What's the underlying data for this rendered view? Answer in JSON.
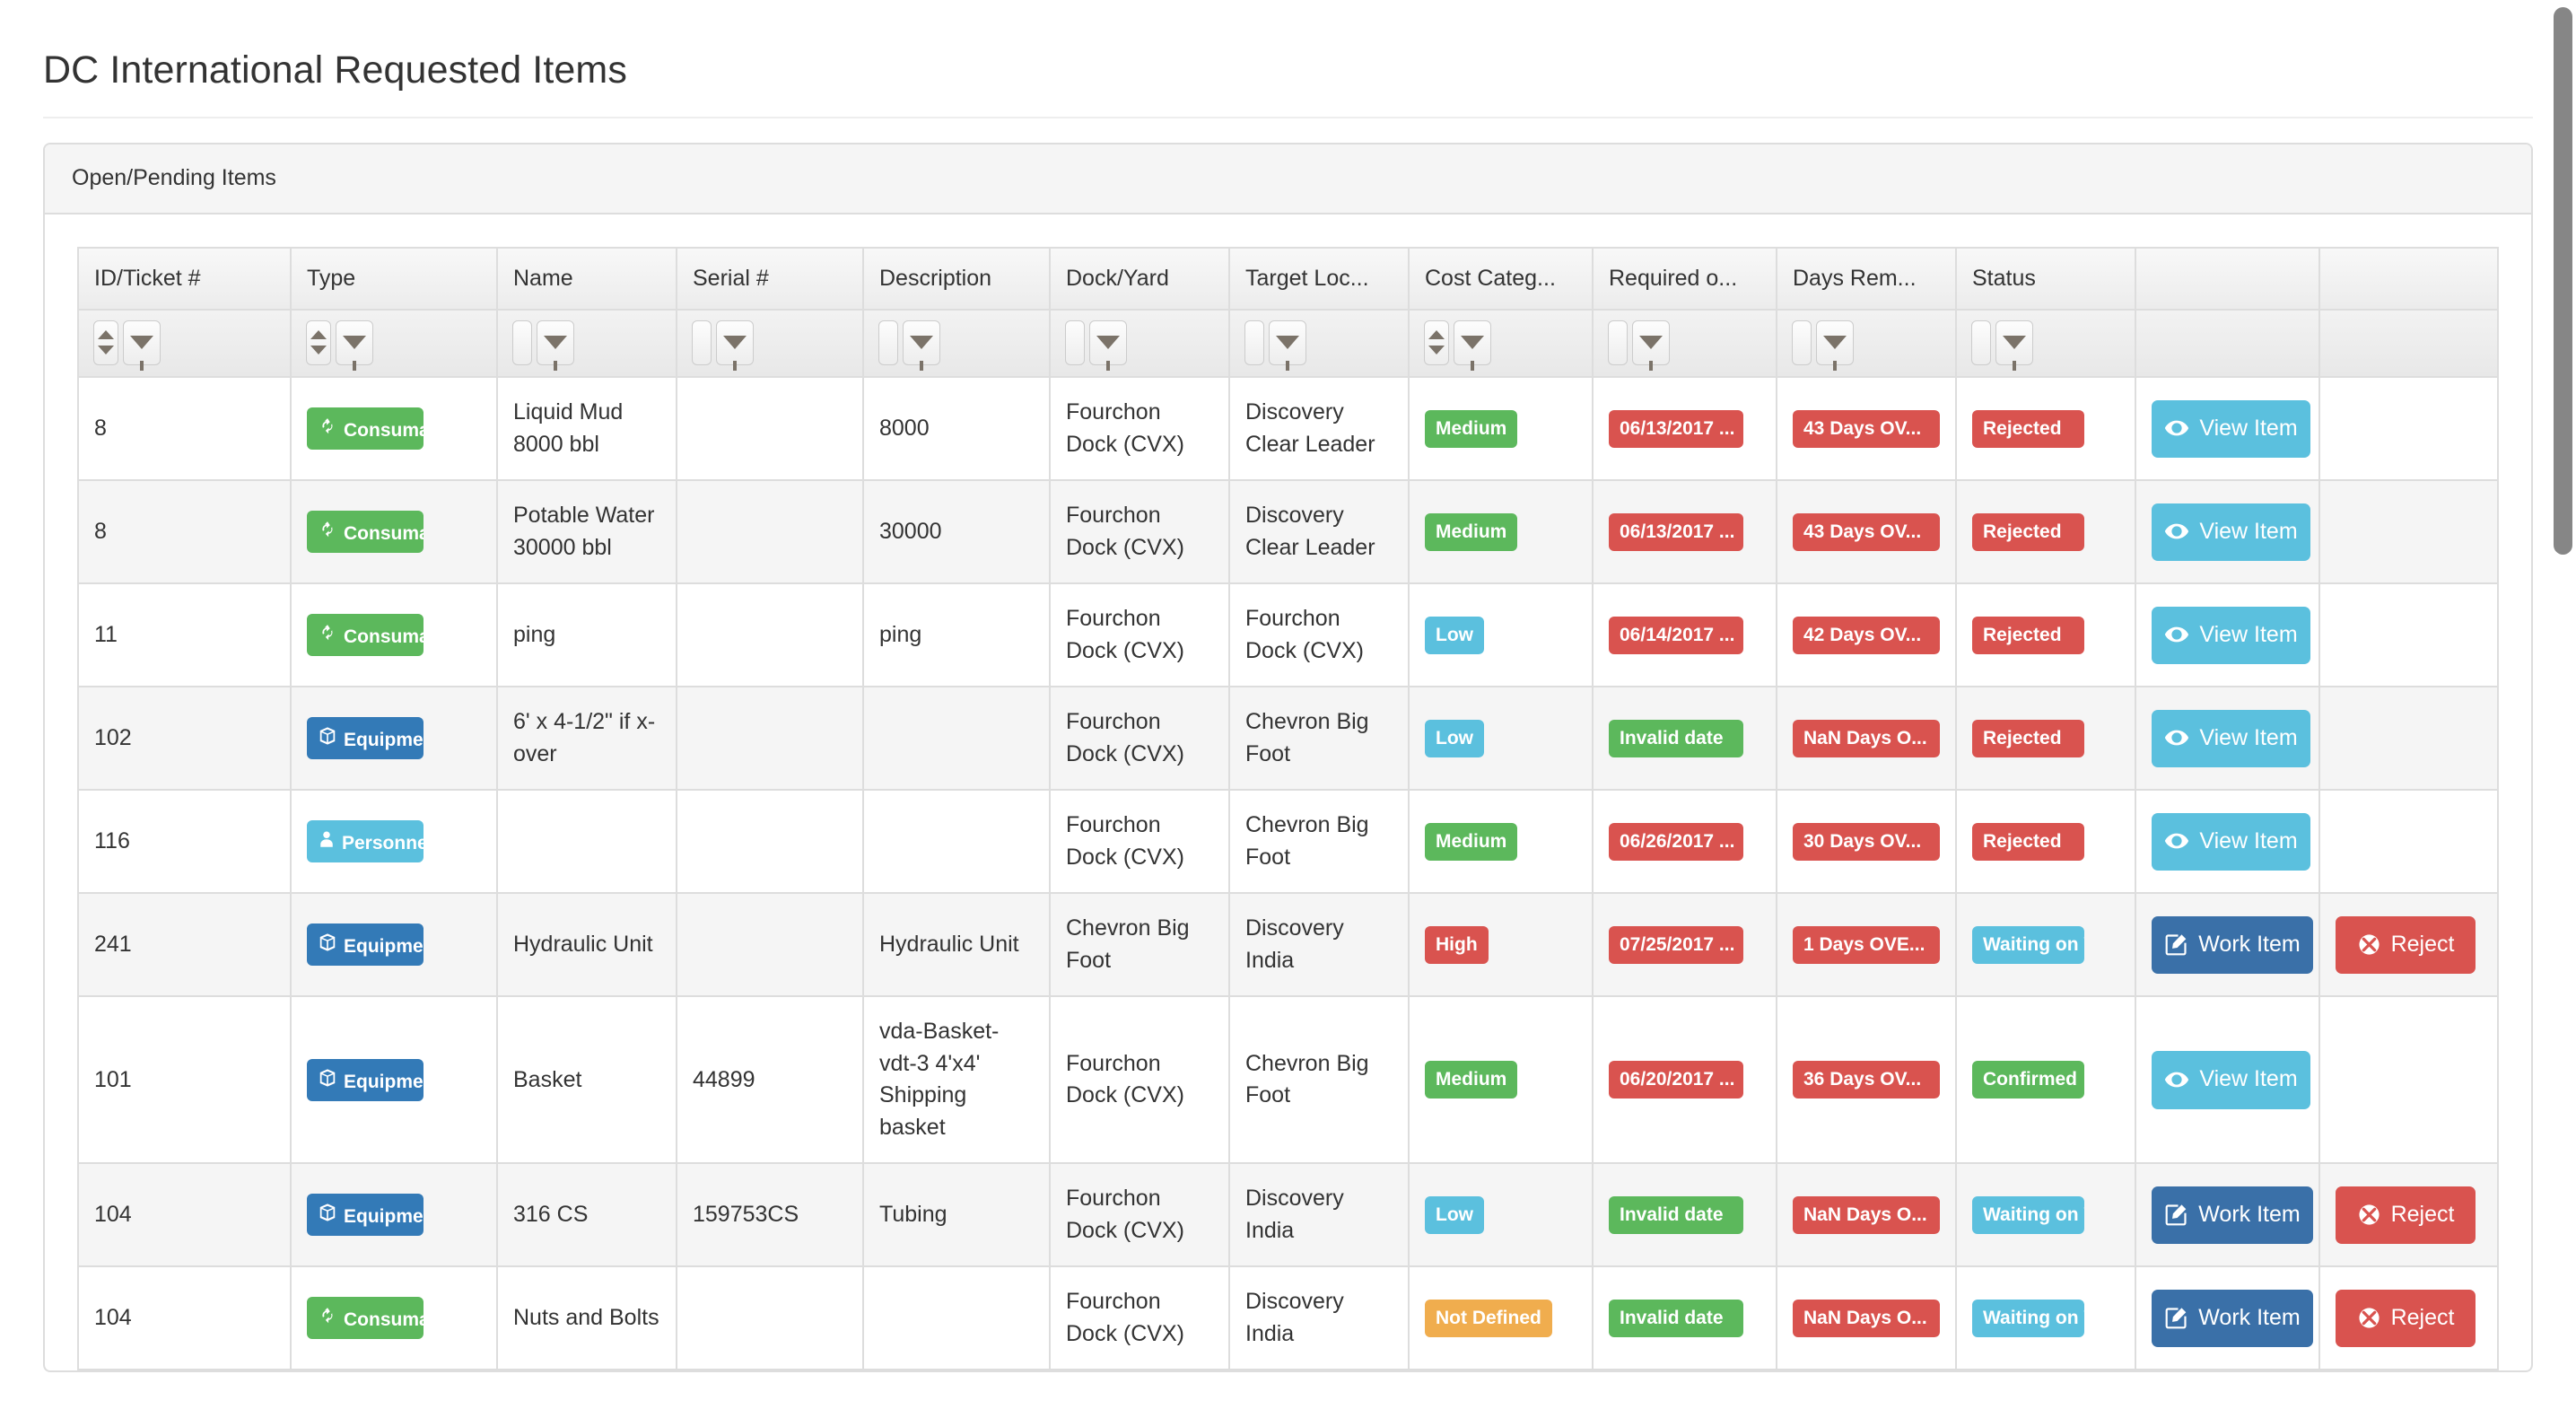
{
  "page": {
    "title": "DC International Requested Items"
  },
  "panel": {
    "heading": "Open/Pending Items"
  },
  "grid": {
    "columns": [
      {
        "label": "ID/Ticket #",
        "sortable": true,
        "filter": true
      },
      {
        "label": "Type",
        "sortable": true,
        "filter": true
      },
      {
        "label": "Name",
        "sortable": false,
        "filter": true
      },
      {
        "label": "Serial #",
        "sortable": false,
        "filter": true
      },
      {
        "label": "Description",
        "sortable": false,
        "filter": true
      },
      {
        "label": "Dock/Yard",
        "sortable": false,
        "filter": true
      },
      {
        "label": "Target Loc...",
        "sortable": false,
        "filter": true
      },
      {
        "label": "Cost Categ...",
        "sortable": true,
        "filter": true
      },
      {
        "label": "Required o...",
        "sortable": false,
        "filter": true
      },
      {
        "label": "Days Rem...",
        "sortable": false,
        "filter": true
      },
      {
        "label": "Status",
        "sortable": false,
        "filter": true
      },
      {
        "label": "",
        "sortable": false,
        "filter": false
      },
      {
        "label": "",
        "sortable": false,
        "filter": false
      }
    ],
    "rows": [
      {
        "id": "8",
        "type": {
          "text": "Consuma...",
          "color": "green",
          "icon": "recycle-icon"
        },
        "name": "Liquid Mud 8000 bbl",
        "serial": "",
        "description": "8000",
        "dock_yard": "Fourchon Dock (CVX)",
        "target_location": "Discovery Clear Leader",
        "cost_category": {
          "text": "Medium",
          "color": "green"
        },
        "required_on": {
          "text": "06/13/2017 ...",
          "color": "red"
        },
        "days_remaining": {
          "text": "43 Days OV...",
          "color": "red"
        },
        "status": {
          "text": "Rejected",
          "color": "red"
        },
        "primary_action": {
          "label": "View Item",
          "style": "view",
          "icon": "eye-icon"
        },
        "secondary_action": null
      },
      {
        "id": "8",
        "type": {
          "text": "Consuma...",
          "color": "green",
          "icon": "recycle-icon"
        },
        "name": "Potable Water 30000 bbl",
        "serial": "",
        "description": "30000",
        "dock_yard": "Fourchon Dock (CVX)",
        "target_location": "Discovery Clear Leader",
        "cost_category": {
          "text": "Medium",
          "color": "green"
        },
        "required_on": {
          "text": "06/13/2017 ...",
          "color": "red"
        },
        "days_remaining": {
          "text": "43 Days OV...",
          "color": "red"
        },
        "status": {
          "text": "Rejected",
          "color": "red"
        },
        "primary_action": {
          "label": "View Item",
          "style": "view",
          "icon": "eye-icon"
        },
        "secondary_action": null
      },
      {
        "id": "11",
        "type": {
          "text": "Consuma...",
          "color": "green",
          "icon": "recycle-icon"
        },
        "name": "ping",
        "serial": "",
        "description": "ping",
        "dock_yard": "Fourchon Dock (CVX)",
        "target_location": "Fourchon Dock (CVX)",
        "cost_category": {
          "text": "Low",
          "color": "lblue"
        },
        "required_on": {
          "text": "06/14/2017 ...",
          "color": "red"
        },
        "days_remaining": {
          "text": "42 Days OV...",
          "color": "red"
        },
        "status": {
          "text": "Rejected",
          "color": "red"
        },
        "primary_action": {
          "label": "View Item",
          "style": "view",
          "icon": "eye-icon"
        },
        "secondary_action": null
      },
      {
        "id": "102",
        "type": {
          "text": "Equipment",
          "color": "blue",
          "icon": "cube-icon"
        },
        "name": "6' x 4-1/2\" if x- over",
        "serial": "",
        "description": "",
        "dock_yard": "Fourchon Dock (CVX)",
        "target_location": "Chevron Big Foot",
        "cost_category": {
          "text": "Low",
          "color": "lblue"
        },
        "required_on": {
          "text": "Invalid date",
          "color": "green"
        },
        "days_remaining": {
          "text": "NaN Days O...",
          "color": "red"
        },
        "status": {
          "text": "Rejected",
          "color": "red"
        },
        "primary_action": {
          "label": "View Item",
          "style": "view",
          "icon": "eye-icon"
        },
        "secondary_action": null
      },
      {
        "id": "116",
        "type": {
          "text": "Personnel",
          "color": "lblue",
          "icon": "user-icon"
        },
        "name": "",
        "serial": "",
        "description": "",
        "dock_yard": "Fourchon Dock (CVX)",
        "target_location": "Chevron Big Foot",
        "cost_category": {
          "text": "Medium",
          "color": "green"
        },
        "required_on": {
          "text": "06/26/2017 ...",
          "color": "red"
        },
        "days_remaining": {
          "text": "30 Days OV...",
          "color": "red"
        },
        "status": {
          "text": "Rejected",
          "color": "red"
        },
        "primary_action": {
          "label": "View Item",
          "style": "view",
          "icon": "eye-icon"
        },
        "secondary_action": null
      },
      {
        "id": "241",
        "type": {
          "text": "Equipment",
          "color": "blue",
          "icon": "cube-icon"
        },
        "name": "Hydraulic Unit",
        "serial": "",
        "description": "Hydraulic Unit",
        "dock_yard": "Chevron Big Foot",
        "target_location": "Discovery India",
        "cost_category": {
          "text": "High",
          "color": "red"
        },
        "required_on": {
          "text": "07/25/2017 ...",
          "color": "red"
        },
        "days_remaining": {
          "text": "1 Days OVE...",
          "color": "red"
        },
        "status": {
          "text": "Waiting on V...",
          "color": "lblue"
        },
        "primary_action": {
          "label": "Work Item",
          "style": "work",
          "icon": "edit-icon"
        },
        "secondary_action": {
          "label": "Reject",
          "style": "reject",
          "icon": "ban-icon"
        }
      },
      {
        "id": "101",
        "type": {
          "text": "Equipment",
          "color": "blue",
          "icon": "cube-icon"
        },
        "name": "Basket",
        "serial": "44899",
        "description": "vda-Basket-vdt-3 4'x4' Shipping basket",
        "dock_yard": "Fourchon Dock (CVX)",
        "target_location": "Chevron Big Foot",
        "cost_category": {
          "text": "Medium",
          "color": "green"
        },
        "required_on": {
          "text": "06/20/2017 ...",
          "color": "red"
        },
        "days_remaining": {
          "text": "36 Days OV...",
          "color": "red"
        },
        "status": {
          "text": "Confirmed",
          "color": "green"
        },
        "primary_action": {
          "label": "View Item",
          "style": "view",
          "icon": "eye-icon"
        },
        "secondary_action": null
      },
      {
        "id": "104",
        "type": {
          "text": "Equipment",
          "color": "blue",
          "icon": "cube-icon"
        },
        "name": "316 CS",
        "serial": "159753CS",
        "description": "Tubing",
        "dock_yard": "Fourchon Dock (CVX)",
        "target_location": "Discovery India",
        "cost_category": {
          "text": "Low",
          "color": "lblue"
        },
        "required_on": {
          "text": "Invalid date",
          "color": "green"
        },
        "days_remaining": {
          "text": "NaN Days O...",
          "color": "red"
        },
        "status": {
          "text": "Waiting on V...",
          "color": "lblue"
        },
        "primary_action": {
          "label": "Work Item",
          "style": "work",
          "icon": "edit-icon"
        },
        "secondary_action": {
          "label": "Reject",
          "style": "reject",
          "icon": "ban-icon"
        }
      },
      {
        "id": "104",
        "type": {
          "text": "Consuma...",
          "color": "green",
          "icon": "recycle-icon"
        },
        "name": "Nuts and Bolts",
        "serial": "",
        "description": "",
        "dock_yard": "Fourchon Dock (CVX)",
        "target_location": "Discovery India",
        "cost_category": {
          "text": "Not Defined",
          "color": "orange"
        },
        "required_on": {
          "text": "Invalid date",
          "color": "green"
        },
        "days_remaining": {
          "text": "NaN Days O...",
          "color": "red"
        },
        "status": {
          "text": "Waiting on V...",
          "color": "lblue"
        },
        "primary_action": {
          "label": "Work Item",
          "style": "work",
          "icon": "edit-icon"
        },
        "secondary_action": {
          "label": "Reject",
          "style": "reject",
          "icon": "ban-icon"
        }
      }
    ]
  },
  "colors": {
    "green": "#5cb85c",
    "blue": "#337ab7",
    "light_blue": "#5bc0de",
    "red": "#d9534f",
    "orange": "#f0ad4e",
    "work_button": "#3a70a8"
  }
}
